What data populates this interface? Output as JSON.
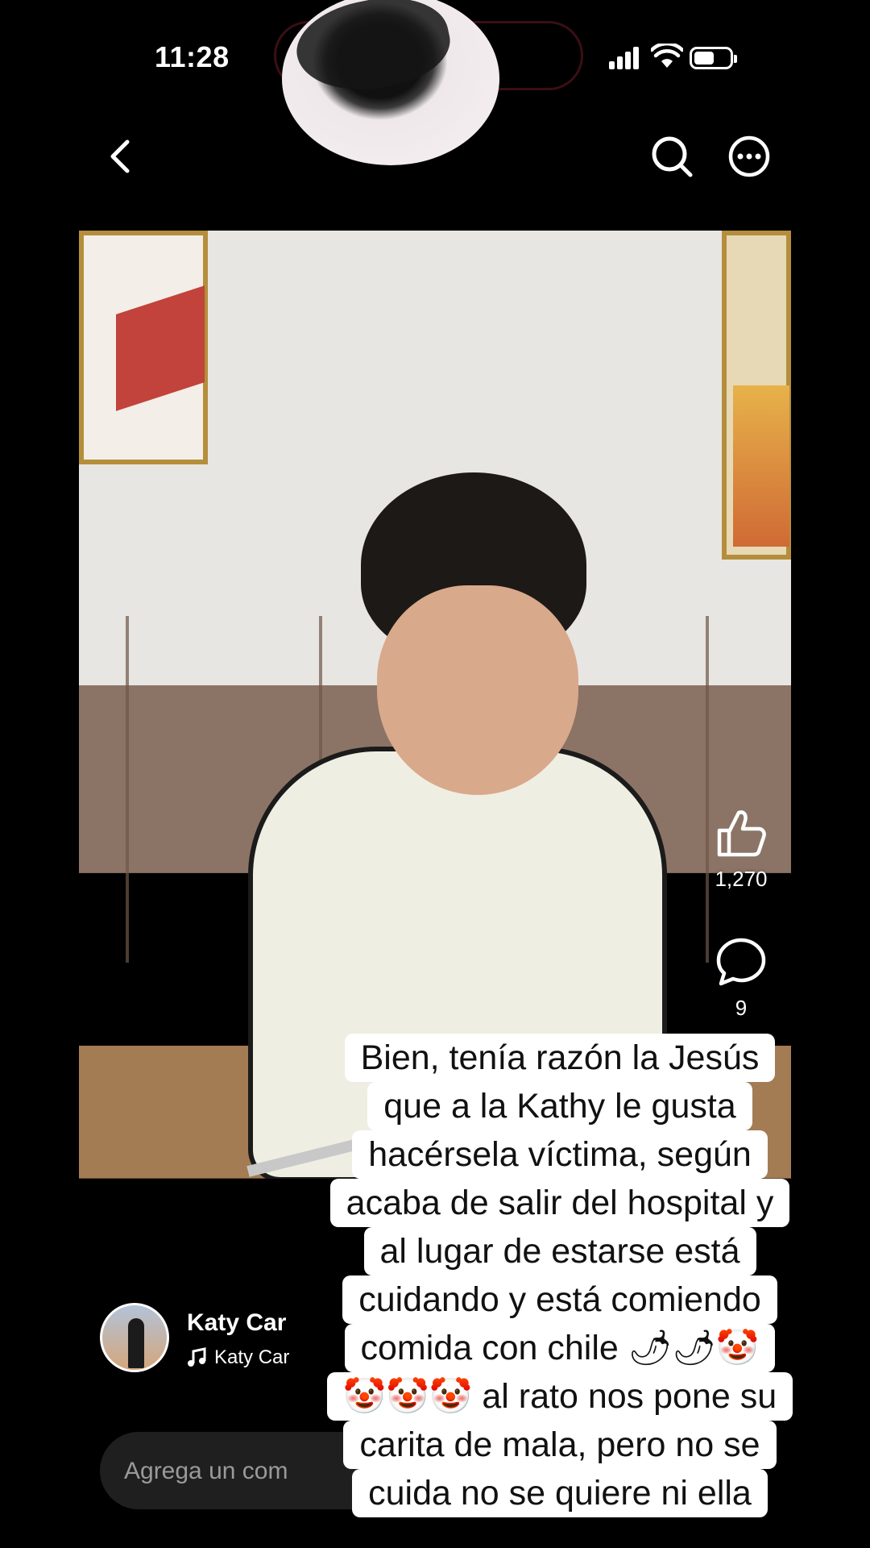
{
  "status_bar": {
    "time": "11:28"
  },
  "post": {
    "likes": "1,270",
    "comments": "9",
    "author_name": "Katy Car",
    "music_label": "Katy Car"
  },
  "comment_box": {
    "placeholder": "Agrega un com"
  },
  "caption": {
    "lines": [
      "Bien, tenía razón la Jesús",
      "que a la Kathy le gusta",
      "hacérsela víctima, según",
      "acaba de salir del hospital y",
      "al lugar de estarse está",
      "cuidando y está  comiendo",
      "comida con   chile 🌶🌶🤡",
      "🤡🤡🤡 al rato nos pone su",
      "carita de mala, pero no se",
      "cuida no se quiere ni ella"
    ]
  },
  "icons": {
    "back": "chevron-left-icon",
    "search": "search-icon",
    "more": "more-icon",
    "like": "thumbs-up-icon",
    "comment": "comment-bubble-icon",
    "music": "music-note-icon"
  }
}
